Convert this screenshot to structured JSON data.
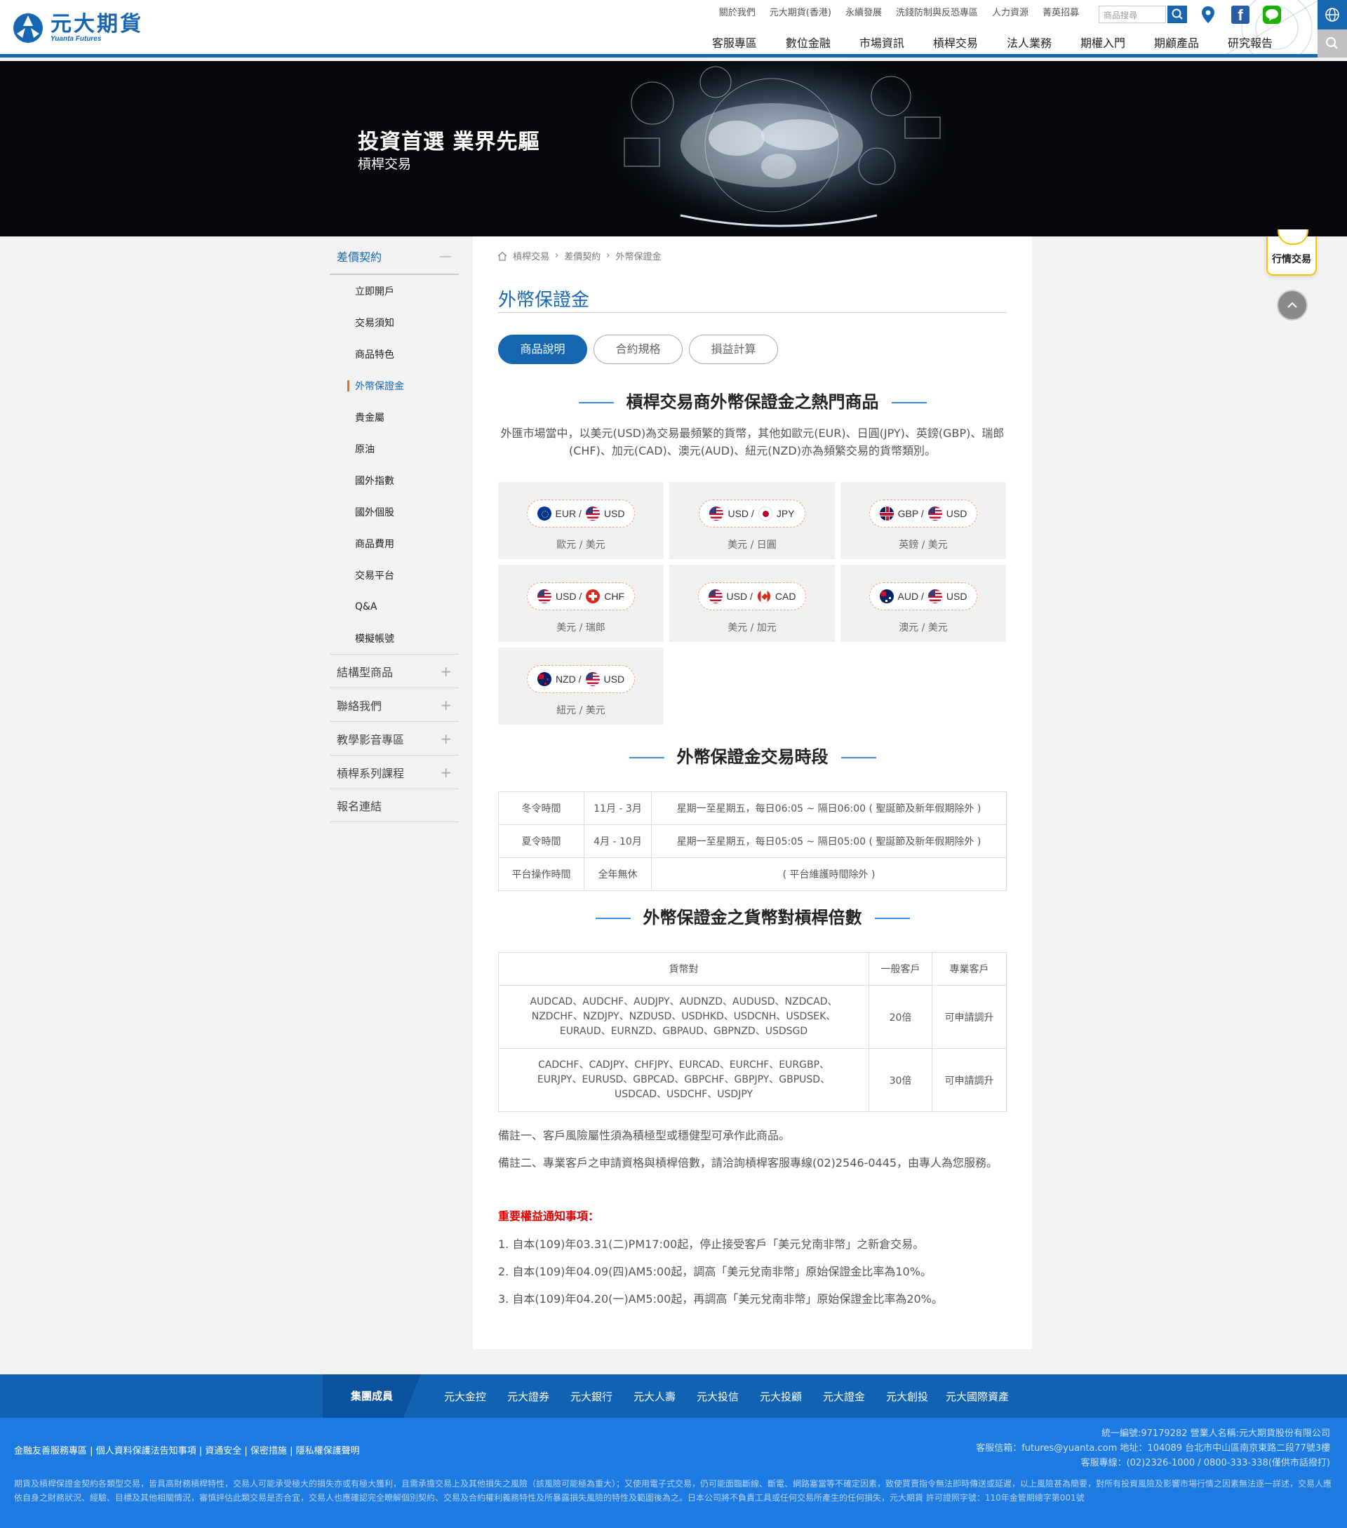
{
  "header": {
    "logo_cn": "元大期貨",
    "logo_en": "Yuanta Futures",
    "top_links": [
      "關於我們",
      "元大期貨(香港)",
      "永續發展",
      "洗錢防制與反恐專區",
      "人力資源",
      "菁英招募"
    ],
    "search_placeholder": "商品搜尋",
    "main_nav": [
      "客服專區",
      "數位金融",
      "市場資訊",
      "槓桿交易",
      "法人業務",
      "期權入門",
      "期顧產品",
      "研究報告"
    ]
  },
  "banner": {
    "title": "投資首選 業界先驅",
    "subtitle": "槓桿交易"
  },
  "sidebar": {
    "head": "差價契約",
    "items": [
      "立即開戶",
      "交易須知",
      "商品特色",
      "外幣保證金",
      "貴金屬",
      "原油",
      "國外指數",
      "國外個股",
      "商品費用",
      "交易平台",
      "Q&A",
      "模擬帳號"
    ],
    "active_index": 3,
    "groups": [
      "結構型商品",
      "聯絡我們",
      "教學影音專區",
      "槓桿系列課程",
      "報名連結"
    ]
  },
  "breadcrumb": [
    "槓桿交易",
    "差價契約",
    "外幣保證金"
  ],
  "page_title": "外幣保證金",
  "tabs": [
    "商品說明",
    "合約規格",
    "損益計算"
  ],
  "section1": {
    "title": "槓桿交易商外幣保證金之熱門商品",
    "intro": "外匯市場當中，以美元(USD)為交易最頻繁的貨幣，其他如歐元(EUR)、日圓(JPY)、英鎊(GBP)、瑞郎(CHF)、加元(CAD)、澳元(AUD)、紐元(NZD)亦為頻繁交易的貨幣類別。",
    "pairs": [
      {
        "base": "EUR",
        "quote": "USD",
        "base_label": "EUR /",
        "quote_label": "USD",
        "cn": "歐元 / 美元"
      },
      {
        "base": "USD",
        "quote": "JPY",
        "base_label": "USD /",
        "quote_label": "JPY",
        "cn": "美元 / 日圓"
      },
      {
        "base": "GBP",
        "quote": "USD",
        "base_label": "GBP /",
        "quote_label": "USD",
        "cn": "英鎊 / 美元"
      },
      {
        "base": "USD",
        "quote": "CHF",
        "base_label": "USD /",
        "quote_label": "CHF",
        "cn": "美元 / 瑞郎"
      },
      {
        "base": "USD",
        "quote": "CAD",
        "base_label": "USD /",
        "quote_label": "CAD",
        "cn": "美元 / 加元"
      },
      {
        "base": "AUD",
        "quote": "USD",
        "base_label": "AUD /",
        "quote_label": "USD",
        "cn": "澳元 / 美元"
      },
      {
        "base": "NZD",
        "quote": "USD",
        "base_label": "NZD /",
        "quote_label": "USD",
        "cn": "紐元 / 美元"
      }
    ]
  },
  "section2": {
    "title": "外幣保證金交易時段",
    "rows": [
      [
        "冬令時間",
        "11月 - 3月",
        "星期一至星期五，每日06:05 ~ 隔日06:00 ( 聖誕節及新年假期除外 )"
      ],
      [
        "夏令時間",
        "4月 - 10月",
        "星期一至星期五，每日05:05 ~ 隔日05:00 ( 聖誕節及新年假期除外 )"
      ],
      [
        "平台操作時間",
        "全年無休",
        "( 平台維護時間除外 )"
      ]
    ]
  },
  "section3": {
    "title": "外幣保證金之貨幣對槓桿倍數",
    "headers": [
      "貨幣對",
      "一般客戶",
      "專業客戶"
    ],
    "rows": [
      {
        "pairs": "AUDCAD、AUDCHF、AUDJPY、AUDNZD、AUDUSD、NZDCAD、NZDCHF、NZDJPY、NZDUSD、USDHKD、USDCNH、USDSEK、EURAUD、EURNZD、GBPAUD、GBPNZD、USDSGD",
        "normal": "20倍",
        "pro": "可申請調升"
      },
      {
        "pairs": "CADCHF、CADJPY、CHFJPY、EURCAD、EURCHF、EURGBP、EURJPY、EURUSD、GBPCAD、GBPCHF、GBPJPY、GBPUSD、USDCAD、USDCHF、USDJPY",
        "normal": "30倍",
        "pro": "可申請調升"
      }
    ]
  },
  "notes": [
    "備註一、客戶風險屬性須為積極型或穩健型可承作此商品。",
    "備註二、專業客戶之申請資格與槓桿倍數，請洽詢槓桿客服專線(02)2546-0445，由專人為您服務。"
  ],
  "notice": {
    "title": "重要權益通知事項：",
    "items": [
      "1. 自本(109)年03.31(二)PM17:00起，停止接受客戶「美元兌南非幣」之新倉交易。",
      "2. 自本(109)年04.09(四)AM5:00起，調高「美元兌南非幣」原始保證金比率為10%。",
      "3. 自本(109)年04.20(一)AM5:00起，再調高「美元兌南非幣」原始保證金比率為20%。"
    ]
  },
  "widgets": {
    "quote_label": "行情交易"
  },
  "footer": {
    "group_label": "集團成員",
    "group_links": [
      "元大金控",
      "元大證券",
      "元大銀行",
      "元大人壽",
      "元大投信",
      "元大投顧",
      "元大證金",
      "元大創投",
      "元大國際資產"
    ],
    "bottom_links": "金融友善服務專區 | 個人資料保護法告知事項 | 資通安全 | 保密措施 | 隱私權保護聲明",
    "company_info": [
      "統一編號:97179282  營業人名稱:元大期貨股份有限公司",
      "客服信箱：futures@yuanta.com  地址：104089 台北市中山區南京東路二段77號3樓",
      "客服專線：(02)2326-1000 / 0800-333-338(僅供市話撥打)"
    ],
    "disclaimer": "期貨及槓桿保證金契約各類型交易，皆具高財務槓桿特性，交易人可能承受極大的損失亦或有極大獲利，且需承擔交易上及其他損失之風險（該風險可能極為重大）；又使用電子式交易，仍可能面臨斷線、斷電、網路塞當等不確定因素，致使買賣指令無法即時傳送或延遲，以上風險甚為簡要，對所有投資風險及影響市場行情之因素無法逐一詳述，交易人應依自身之財務狀況、經驗、目標及其他相關情況，審慎評估此類交易是否合宜，交易人也應確認完全瞭解個別契約、交易及合約權利義務特性及所暴露損失風險的特性及範圍後為之。日本公司將不負責工具或任何交易所產生的任何損失，元大期貨 許可證照字號：110年金管期總字第001號"
  }
}
